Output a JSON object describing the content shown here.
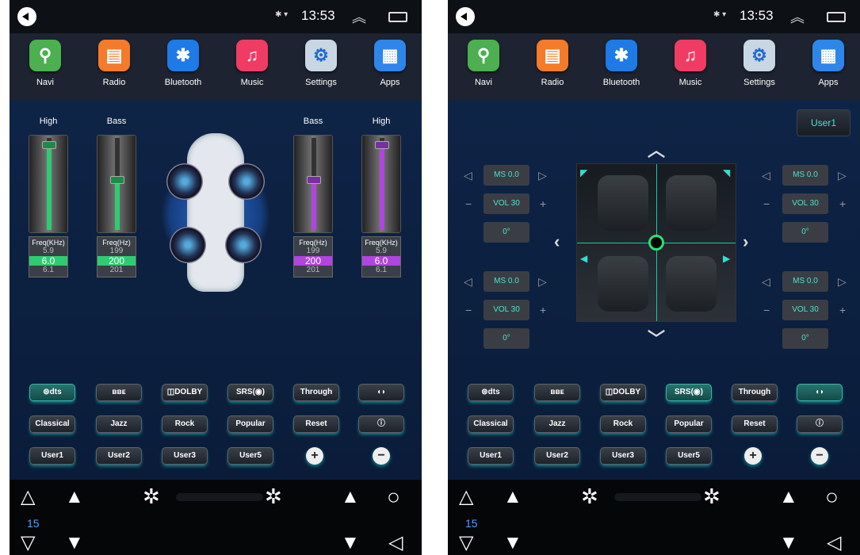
{
  "status": {
    "time": "13:53",
    "icons": "✱ ▾"
  },
  "apps": [
    {
      "label": "Navi",
      "color": "#4caf50",
      "glyph": "⚲"
    },
    {
      "label": "Radio",
      "color": "#f37b2a",
      "glyph": "▤"
    },
    {
      "label": "Bluetooth",
      "color": "#1e7ae6",
      "glyph": "✱"
    },
    {
      "label": "Music",
      "color": "#f03c64",
      "glyph": "♫"
    },
    {
      "label": "Settings",
      "color": "#c9d6e3",
      "glyph": "⚙"
    },
    {
      "label": "Apps",
      "color": "#2f86ea",
      "glyph": "▦"
    }
  ],
  "eq": {
    "left_high": {
      "title": "High",
      "freq_label": "Freq(KHz)",
      "prev": "5.9",
      "value": "6.0",
      "next": "6.1",
      "level": 0.9,
      "color": "#2ecc71"
    },
    "left_bass": {
      "title": "Bass",
      "freq_label": "Freq(Hz)",
      "prev": "199",
      "value": "200",
      "next": "201",
      "level": 0.55,
      "color": "#2ecc71"
    },
    "right_bass": {
      "title": "Bass",
      "freq_label": "Freq(Hz)",
      "prev": "199",
      "value": "200",
      "next": "201",
      "level": 0.55,
      "color": "#b045e0"
    },
    "right_high": {
      "title": "High",
      "freq_label": "Freq(KHz)",
      "prev": "5.9",
      "value": "6.0",
      "next": "6.1",
      "level": 0.9,
      "color": "#b045e0"
    }
  },
  "effects_row1": [
    "⊜dts",
    "ʙʙᴇ",
    "◫DOLBY",
    "SRS(◉)",
    "Through",
    "◖◗"
  ],
  "effects_row2": [
    "Classical",
    "Jazz",
    "Rock",
    "Popular",
    "Reset",
    "ⓘ"
  ],
  "effects_row3": [
    "User1",
    "User2",
    "User3",
    "User5",
    "+",
    "−"
  ],
  "sound_field": {
    "preset_label": "User1",
    "zones": [
      {
        "ms": "MS 0.0",
        "vol": "VOL 30",
        "angle": "0°"
      },
      {
        "ms": "MS 0.0",
        "vol": "VOL 30",
        "angle": "0°"
      },
      {
        "ms": "MS 0.0",
        "vol": "VOL 30",
        "angle": "0°"
      },
      {
        "ms": "MS 0.0",
        "vol": "VOL 30",
        "angle": "0°"
      }
    ]
  },
  "bottom": {
    "temp": "15"
  },
  "colors": {
    "accent": "#4de0d0",
    "background": "#0a1a33",
    "left_eq": "#2ecc71",
    "right_eq": "#b045e0"
  }
}
